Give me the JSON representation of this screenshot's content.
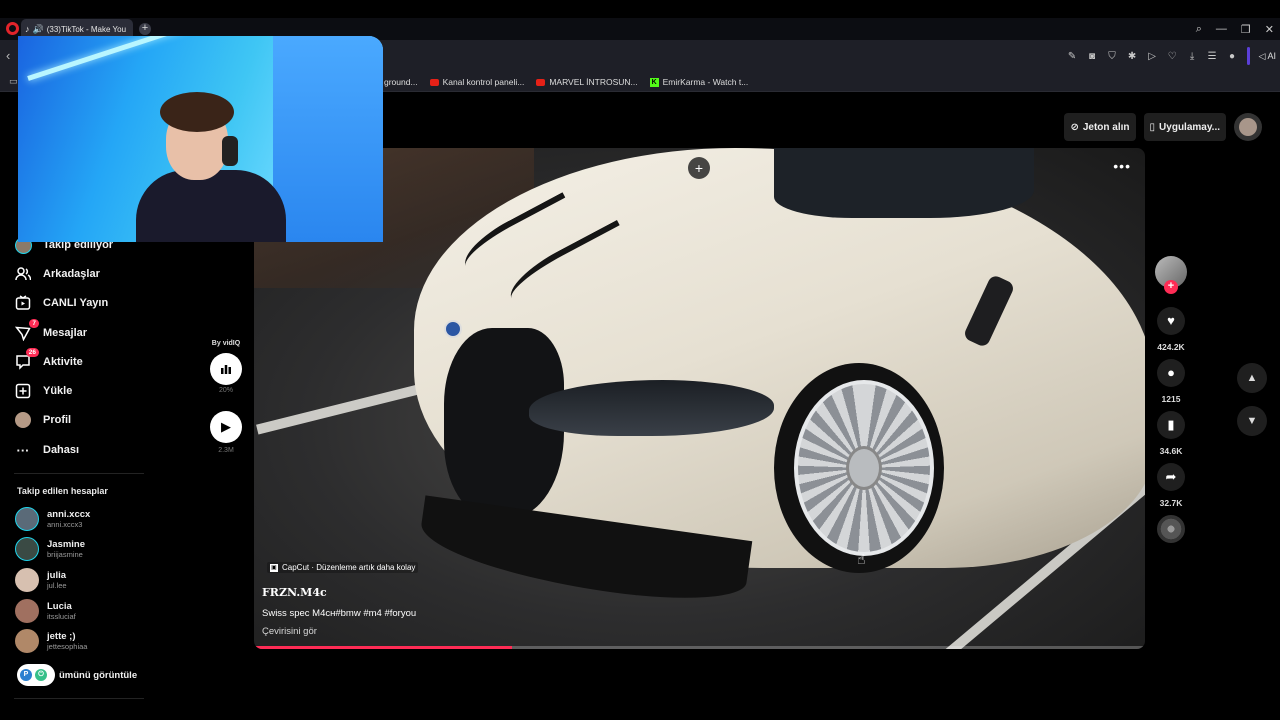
{
  "browser": {
    "tab_title": "(33)TikTok - Make You",
    "bookmarks": [
      {
        "label": "ground...",
        "icon": "none"
      },
      {
        "label": "Kanal kontrol paneli...",
        "icon": "youtube"
      },
      {
        "label": "MARVEL İNTROSUN...",
        "icon": "youtube"
      },
      {
        "label": "EmirKarma - Watch t...",
        "icon": "kick"
      }
    ],
    "ai_label": "AI"
  },
  "sidebar": {
    "nav": [
      {
        "label": "Takip ediliyor",
        "icon": "avatar-ring-icon",
        "badge": ""
      },
      {
        "label": "Arkadaşlar",
        "icon": "friends-icon",
        "badge": ""
      },
      {
        "label": "CANLI Yayın",
        "icon": "live-icon",
        "badge": ""
      },
      {
        "label": "Mesajlar",
        "icon": "messages-icon",
        "badge": "7"
      },
      {
        "label": "Aktivite",
        "icon": "activity-icon",
        "badge": "26"
      },
      {
        "label": "Yükle",
        "icon": "upload-icon",
        "badge": ""
      },
      {
        "label": "Profil",
        "icon": "profile-avatar-icon",
        "badge": ""
      },
      {
        "label": "Dahası",
        "icon": "more-icon",
        "badge": ""
      }
    ],
    "followed_title": "Takip edilen hesaplar",
    "accounts": [
      {
        "name": "anni.xccx",
        "handle": "anni.xccx3",
        "color": "#5a6a78"
      },
      {
        "name": "Jasmine",
        "handle": "briijasmine",
        "color": "#3a4a44"
      },
      {
        "name": "julia",
        "handle": "jul.lee",
        "color": "#d7c0b0"
      },
      {
        "name": "Lucia",
        "handle": "itssluciaf",
        "color": "#a07060"
      },
      {
        "name": "jette ;)",
        "handle": "jettesophiaa",
        "color": "#b08868"
      }
    ],
    "see_all": "ümünü görüntüle"
  },
  "vidiq": {
    "by": "By vidIQ",
    "pct": "20%",
    "count": "2.3M"
  },
  "top_actions": {
    "coins": "Jeton alın",
    "app": "Uygulamay..."
  },
  "video": {
    "capcut": "CapCut · Düzenleme artık daha kolay",
    "author": "FRZN.M4c",
    "caption": "Swiss spec M4ᴄʜ#bmw #m4 #foryou",
    "translate": "Çevirisini gör",
    "progress": 0.29
  },
  "actions": {
    "likes": "424.2K",
    "comments": "1215",
    "saves": "34.6K",
    "shares": "32.7K"
  }
}
